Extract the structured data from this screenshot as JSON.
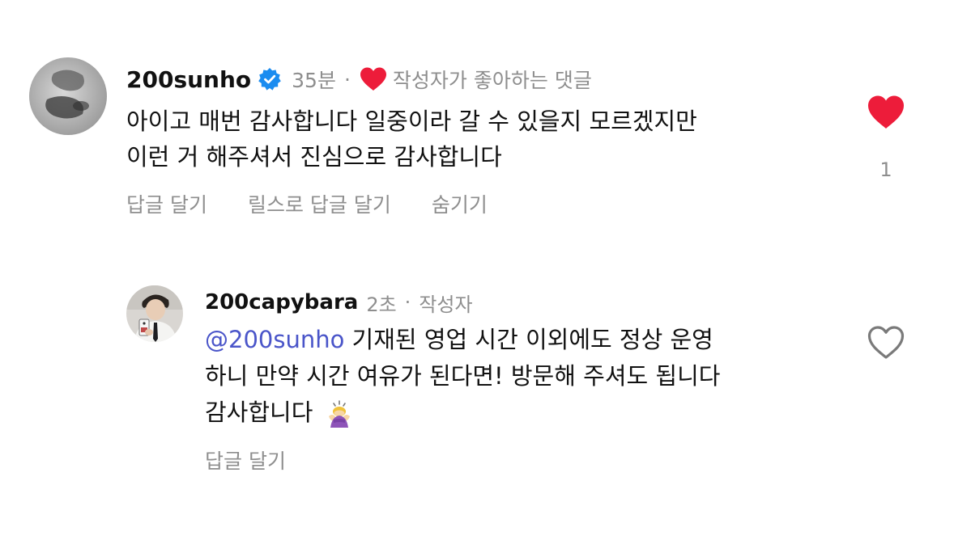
{
  "comment": {
    "username": "200sunho",
    "time": "35분",
    "separator": "·",
    "creator_liked_label": "작성자가 좋아하는 댓글",
    "text_line1": "아이고 매번 감사합니다 일중이라 갈 수 있을지 모르겠지만",
    "text_line2": "이런 거 해주셔서 진심으로 감사합니다",
    "like_count": "1",
    "actions": {
      "reply": "답글 달기",
      "reply_reels": "릴스로 답글 달기",
      "hide": "숨기기"
    }
  },
  "reply": {
    "username": "200capybara",
    "time": "2초",
    "separator": "·",
    "author_badge": "작성자",
    "mention": "@200sunho",
    "text_line1_rest": " 기재된 영업 시간 이외에도 정상 운영",
    "text_line2": "하니 만약 시간 여유가 된다면! 방문해 주셔도 됩니다",
    "text_line3": "감사합니다",
    "emoji": "person-bowing-emoji",
    "actions": {
      "reply": "답글 달기"
    }
  },
  "colors": {
    "like_red": "#ed1c3a",
    "verified_blue": "#1a8cf0",
    "muted_gray": "#8e8e8e",
    "mention_blue": "#4a55c9"
  },
  "icons": {
    "verified": "verified-badge-icon",
    "creator_heart": "heart-filled-icon",
    "like_filled": "heart-filled-icon",
    "like_outline": "heart-outline-icon"
  }
}
